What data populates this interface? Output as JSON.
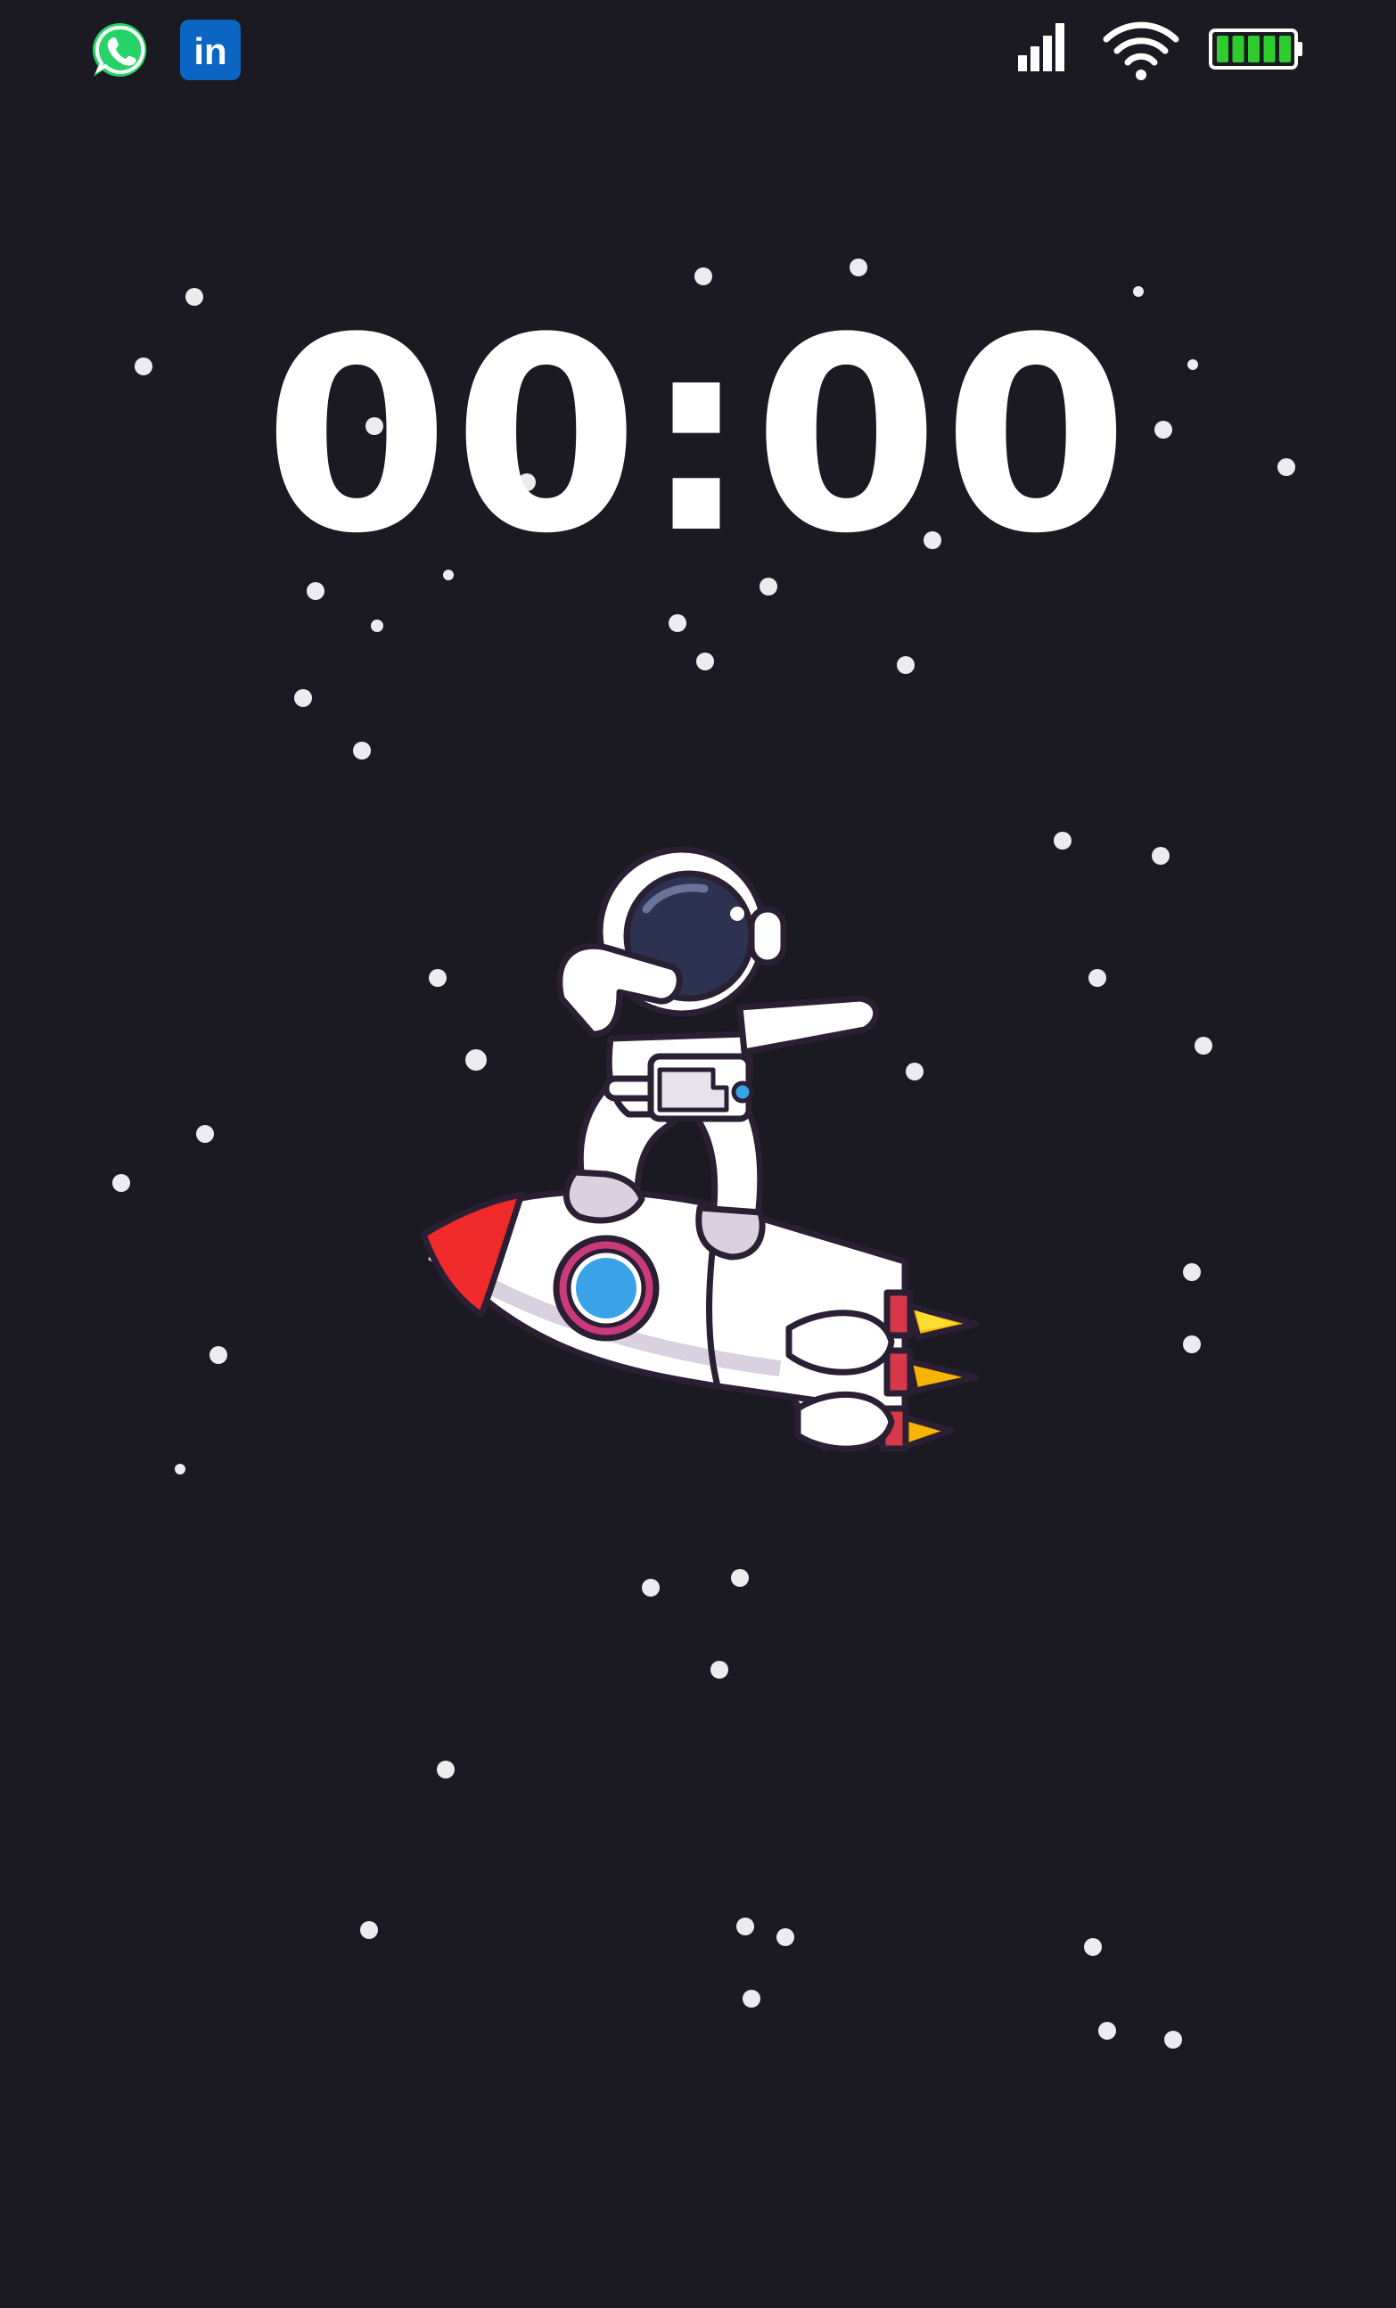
{
  "status_bar": {
    "left_icons": [
      "whatsapp-icon",
      "linkedin-icon"
    ],
    "linkedin_glyph": "in",
    "right_icons": [
      "signal-icon",
      "wifi-icon",
      "battery-icon"
    ],
    "battery_level": 1.0,
    "battery_color": "#2ecc2e"
  },
  "clock": {
    "time": "00:00"
  },
  "wallpaper": {
    "background_color": "#1b1921",
    "subject": "astronaut-on-rocket-illustration"
  }
}
